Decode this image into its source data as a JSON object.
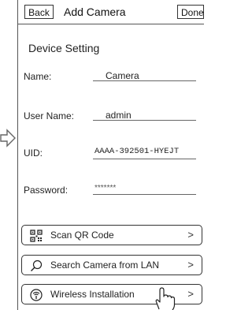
{
  "header": {
    "back_label": "Back",
    "title": "Add Camera",
    "done_label": "Done"
  },
  "device_setting": {
    "title": "Device Setting",
    "fields": [
      {
        "label": "Name:",
        "value": "Camera"
      },
      {
        "label": "User Name:",
        "value": "admin"
      },
      {
        "label": "UID:",
        "value": "AAAA-392501-HYEJT"
      },
      {
        "label": "Password:",
        "value": "*******"
      }
    ]
  },
  "actions": [
    {
      "label": "Scan QR Code",
      "icon": "qr-code-icon",
      "chevron": ">"
    },
    {
      "label": "Search Camera from LAN",
      "icon": "search-icon",
      "chevron": ">"
    },
    {
      "label": "Wireless Installation",
      "icon": "wifi-icon",
      "chevron": ">"
    }
  ]
}
